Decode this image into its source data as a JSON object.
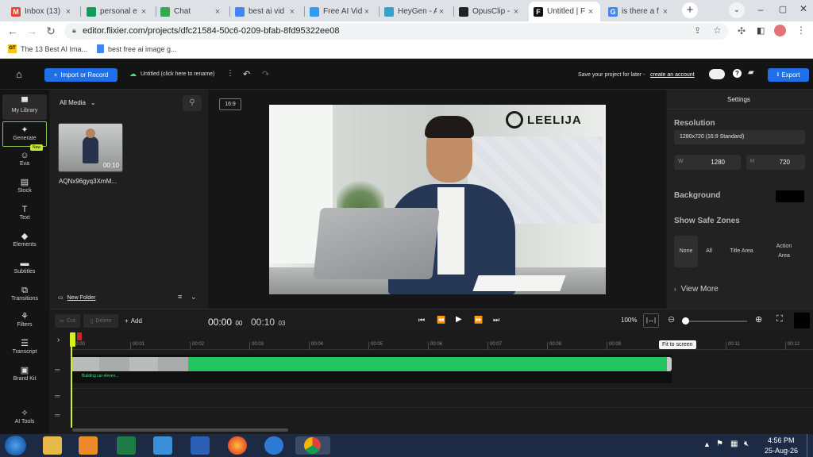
{
  "browser": {
    "tabs": [
      {
        "title": "Inbox (13)",
        "fav_color": "#ea4335",
        "fav_glyph": "M",
        "active": false
      },
      {
        "title": "personal e",
        "fav_color": "#0f9d58",
        "fav_glyph": "",
        "active": false
      },
      {
        "title": "Chat",
        "fav_color": "#34a853",
        "fav_glyph": "",
        "active": false
      },
      {
        "title": "best ai vid",
        "fav_color": "#4285f4",
        "fav_glyph": "",
        "active": false
      },
      {
        "title": "Free AI Vid",
        "fav_color": "#2a9df4",
        "fav_glyph": "",
        "active": false
      },
      {
        "title": "HeyGen - A",
        "fav_color": "#3aa0c9",
        "fav_glyph": "",
        "active": false
      },
      {
        "title": "OpusClip -",
        "fav_color": "#222222",
        "fav_glyph": "",
        "active": false
      },
      {
        "title": "Untitled | F",
        "fav_color": "#111111",
        "fav_glyph": "F",
        "active": true
      },
      {
        "title": "is there a f",
        "fav_color": "#4285f4",
        "fav_glyph": "G",
        "active": false
      }
    ],
    "url": "editor.flixier.com/projects/dfc21584-50c6-0209-bfab-8fd95322ee08",
    "bookmarks": [
      {
        "label": "The 13 Best AI Ima...",
        "icon": "bookmark-logo-icon"
      },
      {
        "label": "best free ai image g...",
        "icon": "google-docs-icon"
      }
    ]
  },
  "app": {
    "import_button": "Import or Record",
    "project_title": "Untitled (click here to rename)",
    "save_prompt": "Save your project for later -",
    "create_account": "create an account",
    "export_button": "Export",
    "nav": [
      {
        "label": "My Library",
        "icon": "folder-icon"
      },
      {
        "label": "Generate",
        "icon": "sparkle-icon"
      },
      {
        "label": "Eva",
        "icon": "eva-icon"
      },
      {
        "label": "Stock",
        "icon": "stock-icon"
      },
      {
        "label": "Text",
        "icon": "text-icon"
      },
      {
        "label": "Elements",
        "icon": "shapes-icon"
      },
      {
        "label": "Subtitles",
        "icon": "subtitles-icon"
      },
      {
        "label": "Transitions",
        "icon": "transitions-icon"
      },
      {
        "label": "Filters",
        "icon": "filters-icon"
      },
      {
        "label": "Transcript",
        "icon": "transcript-icon"
      },
      {
        "label": "Brand Kit",
        "icon": "brand-kit-icon"
      },
      {
        "label": "AI Tools",
        "icon": "ai-tools-icon"
      }
    ],
    "new_badge": "New",
    "media": {
      "filter": "All Media",
      "item_name": "AQNx96gyq3XmM...",
      "item_duration": "00:10",
      "new_folder": "New Folder"
    },
    "preview": {
      "aspect": "16:9",
      "watermark": "LEELIJA"
    },
    "settings": {
      "title": "Settings",
      "resolution_label": "Resolution",
      "resolution_value": "1280x720 (16:9 Standard)",
      "width_label": "W",
      "width_value": "1280",
      "height_label": "H",
      "height_value": "720",
      "background_label": "Background",
      "background_color": "#000000",
      "safe_zones_label": "Show Safe Zones",
      "safe_zone_options": [
        "None",
        "All",
        "Title Area",
        "Action Area"
      ],
      "view_more": "View More"
    },
    "controls": {
      "cut": "Cut",
      "delete": "Delete",
      "add": "Add",
      "current_time_main": "00:00",
      "current_time_frames": "00",
      "total_time_main": "00:10",
      "total_time_frames": "03",
      "zoom": "100%",
      "fit_tooltip": "Fit to screen"
    },
    "timeline": {
      "ticks": [
        "00:00",
        "00:01",
        "00:02",
        "00:03",
        "00:04",
        "00:05",
        "00:06",
        "00:07",
        "00:08",
        "00:09",
        "00:10",
        "00:11",
        "00:12"
      ],
      "clip_caption": "Building car eleven...",
      "clip_color": "#22c55e"
    }
  },
  "taskbar": {
    "time": "4:56 PM",
    "date": "25-Aug-26"
  }
}
